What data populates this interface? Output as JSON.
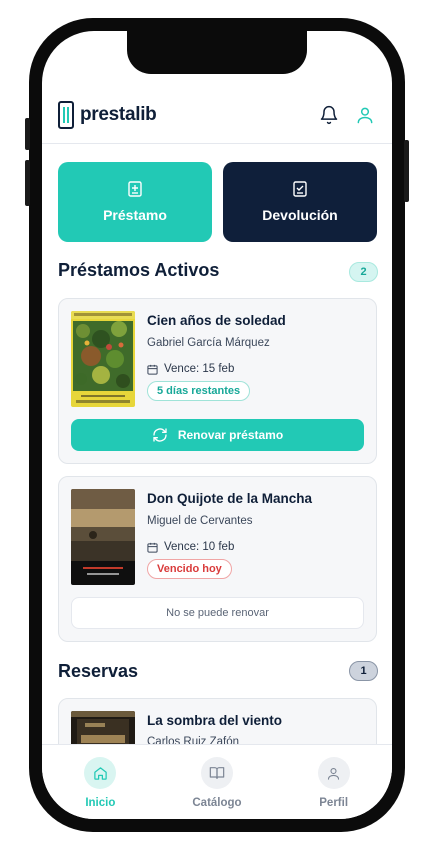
{
  "app": {
    "name": "prestalib"
  },
  "actions": {
    "loan_label": "Préstamo",
    "return_label": "Devolución"
  },
  "active_loans": {
    "title": "Préstamos Activos",
    "count": "2",
    "items": [
      {
        "title": "Cien años de soledad",
        "author": "Gabriel García Márquez",
        "due": "Vence: 15 feb",
        "status": "5 días restantes",
        "action": "Renovar préstamo"
      },
      {
        "title": "Don Quijote de la Mancha",
        "author": "Miguel de Cervantes",
        "due": "Vence: 10 feb",
        "status": "Vencido hoy",
        "action": "No se puede renovar"
      }
    ]
  },
  "reservations": {
    "title": "Reservas",
    "count": "1",
    "items": [
      {
        "title": "La sombra del viento",
        "author": "Carlos Ruiz Zafón"
      }
    ]
  },
  "nav": {
    "home": "Inicio",
    "catalog": "Catálogo",
    "profile": "Perfil"
  },
  "colors": {
    "accent": "#22c9b5",
    "navy": "#0f1f3a",
    "danger": "#d93b3b"
  }
}
